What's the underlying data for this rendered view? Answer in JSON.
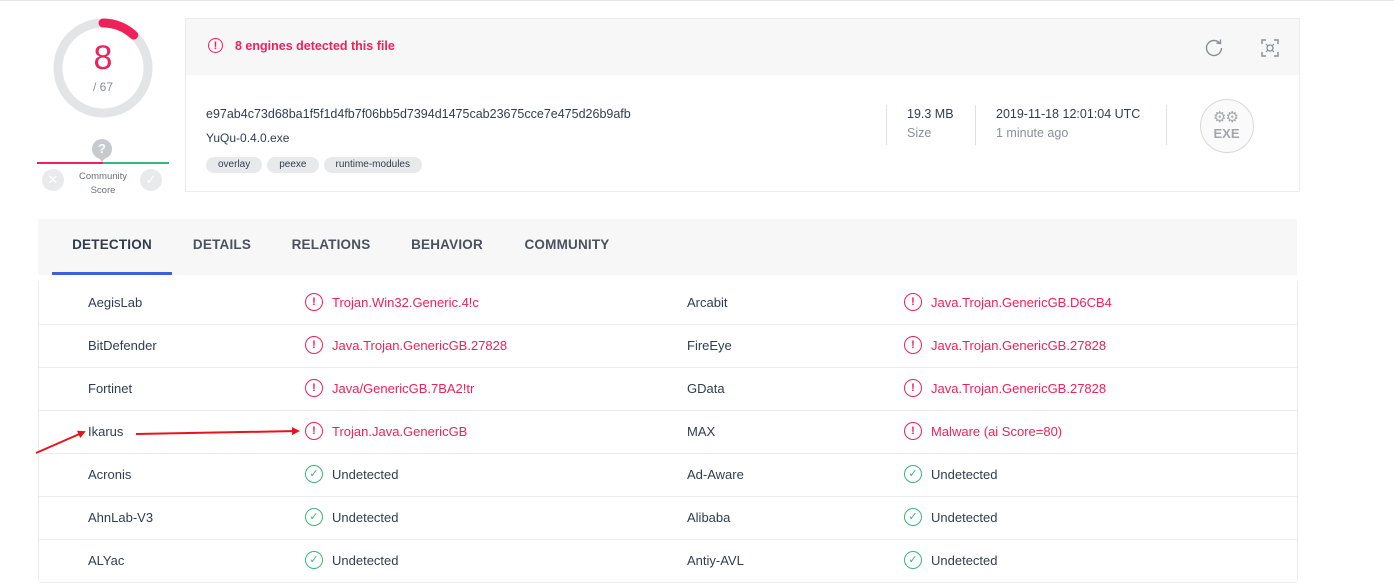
{
  "summary": {
    "score": "8",
    "total": "/ 67",
    "detected_ratio": 0.1194,
    "community_label_1": "Community",
    "community_label_2": "Score",
    "community_unknown": "?"
  },
  "header": {
    "alert_text": "8 engines detected this file",
    "reanalyze_icon": "refresh-icon",
    "similar_icon": "similar-files-icon"
  },
  "file": {
    "hash": "e97ab4c73d68ba1f5f1d4fb7f06bb5d7394d1475cab23675cce7e475d26b9afb",
    "name": "YuQu-0.4.0.exe",
    "tags": [
      "overlay",
      "peexe",
      "runtime-modules"
    ],
    "size": "19.3 MB",
    "size_label": "Size",
    "date": "2019-11-18 12:01:04 UTC",
    "date_relative": "1 minute ago",
    "type_badge": "EXE"
  },
  "tabs": [
    "DETECTION",
    "DETAILS",
    "RELATIONS",
    "BEHAVIOR",
    "COMMUNITY"
  ],
  "active_tab": "DETECTION",
  "detections": [
    {
      "left_engine": "AegisLab",
      "left_result": "Trojan.Win32.Generic.4!c",
      "left_status": "bad",
      "right_engine": "Arcabit",
      "right_result": "Java.Trojan.GenericGB.D6CB4",
      "right_status": "bad"
    },
    {
      "left_engine": "BitDefender",
      "left_result": "Java.Trojan.GenericGB.27828",
      "left_status": "bad",
      "right_engine": "FireEye",
      "right_result": "Java.Trojan.GenericGB.27828",
      "right_status": "bad"
    },
    {
      "left_engine": "Fortinet",
      "left_result": "Java/GenericGB.7BA2!tr",
      "left_status": "bad",
      "right_engine": "GData",
      "right_result": "Java.Trojan.GenericGB.27828",
      "right_status": "bad"
    },
    {
      "left_engine": "Ikarus",
      "left_result": "Trojan.Java.GenericGB",
      "left_status": "bad",
      "right_engine": "MAX",
      "right_result": "Malware (ai Score=80)",
      "right_status": "bad"
    },
    {
      "left_engine": "Acronis",
      "left_result": "Undetected",
      "left_status": "good",
      "right_engine": "Ad-Aware",
      "right_result": "Undetected",
      "right_status": "good"
    },
    {
      "left_engine": "AhnLab-V3",
      "left_result": "Undetected",
      "left_status": "good",
      "right_engine": "Alibaba",
      "right_result": "Undetected",
      "right_status": "good"
    },
    {
      "left_engine": "ALYac",
      "left_result": "Undetected",
      "left_status": "good",
      "right_engine": "Antiy-AVL",
      "right_result": "Undetected",
      "right_status": "good"
    }
  ],
  "colors": {
    "malicious": "#f0205a",
    "clean": "#39b57a",
    "tab_underline": "#3b61e0",
    "annotation_arrow": "#e8141c"
  }
}
